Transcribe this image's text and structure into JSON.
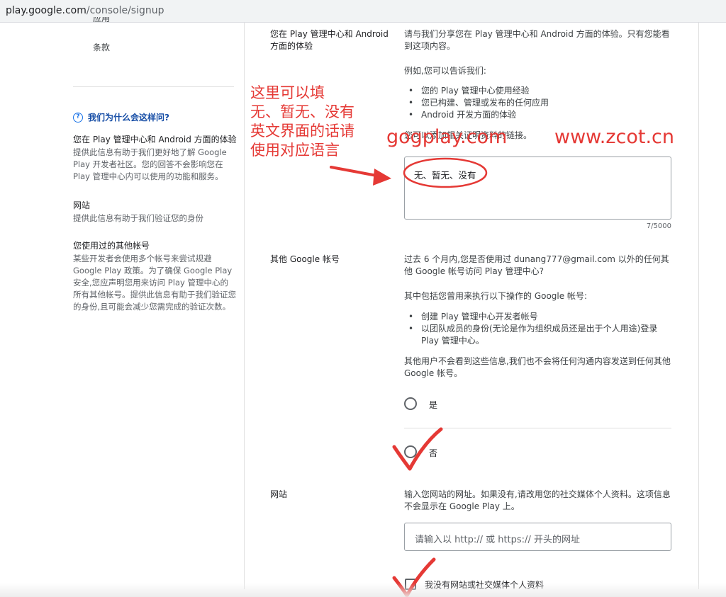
{
  "browser": {
    "url_host": "play.google.com",
    "url_path": "/console/signup"
  },
  "sidebar": {
    "cut_item": "应用",
    "terms": "条款",
    "why_heading": "我们为什么会这样问?",
    "sections": [
      {
        "title": "您在 Play 管理中心和 Android 方面的体验",
        "body": "提供此信息有助于我们更好地了解 Google Play 开发者社区。您的回答不会影响您在 Play 管理中心内可以使用的功能和服务。"
      },
      {
        "title": "网站",
        "body": "提供此信息有助于我们验证您的身份"
      },
      {
        "title": "您使用过的其他帐号",
        "body": "某些开发者会使用多个帐号来尝试规避 Google Play 政策。为了确保 Google Play 安全,您应声明您用来访问 Play 管理中心的所有其他帐号。提供此信息有助于我们验证您的身份,且可能会减少您需完成的验证次数。"
      }
    ]
  },
  "experience": {
    "label": "您在 Play 管理中心和 Android 方面的体验",
    "desc": "请与我们分享您在 Play 管理中心和 Android 方面的体验。只有您能看到这项内容。",
    "example_intro": "例如,您可以告诉我们:",
    "bullets": [
      "您的 Play 管理中心使用经验",
      "您已构建、管理或发布的任何应用",
      "Android 开发方面的体验"
    ],
    "link_note": "您可以添加相关证明资料的链接。",
    "value": "无、暂无、没有",
    "counter": "7/5000"
  },
  "other_accounts": {
    "label": "其他 Google 帐号",
    "desc": "过去 6 个月内,您是否使用过 dunang777@gmail.com 以外的任何其他 Google 帐号访问 Play 管理中心?",
    "includes": "其中包括您曾用来执行以下操作的 Google 帐号:",
    "bullets": [
      "创建 Play 管理中心开发者帐号",
      "以团队成员的身份(无论是作为组织成员还是出于个人用途)登录 Play 管理中心。"
    ],
    "note": "其他用户不会看到这些信息,我们也不会将任何沟通内容发送到任何其他 Google 帐号。",
    "options": [
      "是",
      "否"
    ]
  },
  "website": {
    "label": "网站",
    "desc": "输入您网站的网址。如果没有,请改用您的社交媒体个人资料。这项信息不会显示在 Google Play 上。",
    "placeholder": "请输入以 http:// 或 https:// 开头的网址",
    "no_site_label": "我没有网站或社交媒体个人资料"
  },
  "annotations": {
    "note_lines": [
      "这里可以填",
      "无、暂无、没有",
      "英文界面的话请",
      "使用对应语言"
    ],
    "watermark_left": "gogplay.com",
    "watermark_right": "www.zcot.cn",
    "color": "#e53935"
  }
}
